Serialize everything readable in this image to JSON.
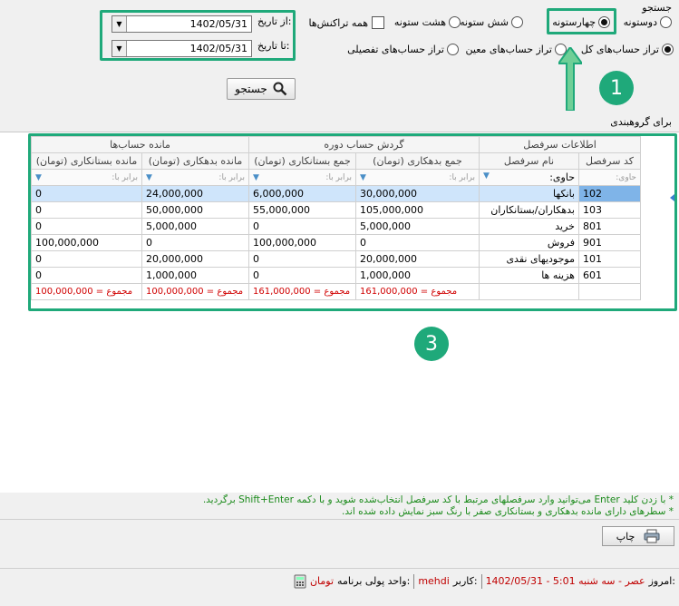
{
  "search": {
    "title": "جستجو",
    "button_label": "جستجو"
  },
  "columns_options": [
    {
      "label": "دوستونه",
      "selected": false
    },
    {
      "label": "چهارستونه",
      "selected": true
    },
    {
      "label": "شش ستونه",
      "selected": false
    },
    {
      "label": "هشت ستونه",
      "selected": false
    }
  ],
  "all_transactions_label": "همه تراکنش‌ها",
  "balance_options": [
    {
      "label": "تراز حساب‌های کل",
      "selected": true
    },
    {
      "label": "تراز حساب‌های معین",
      "selected": false
    },
    {
      "label": "تراز حساب‌های تفصیلی",
      "selected": false
    }
  ],
  "dates": {
    "from_label": "از تاریخ:",
    "from_value": "1402/05/31",
    "to_label": "تا تاریخ:",
    "to_value": "1402/05/31"
  },
  "badges": {
    "one": "1",
    "three": "3"
  },
  "grouping_label": "برای گروهبندی",
  "grid": {
    "groups": {
      "account_info": "اطلاعات سرفصل",
      "period_turnover": "گردش حساب دوره",
      "balance": "مانده حساب‌ها"
    },
    "headers": {
      "code": "کد سرفصل",
      "name": "نام سرفصل",
      "debit_sum": "جمع بدهکاری (تومان)",
      "credit_sum": "جمع بستانکاری (تومان)",
      "debit_balance": "مانده بدهکاری (تومان)",
      "credit_balance": "مانده بستانکاری (تومان)"
    },
    "filters": {
      "contains": "حاوی:",
      "equals": "برابر با:"
    },
    "rows": [
      {
        "code": "102",
        "name": "بانکها",
        "debit_sum": "30,000,000",
        "credit_sum": "6,000,000",
        "debit_balance": "24,000,000",
        "credit_balance": "0"
      },
      {
        "code": "103",
        "name": "بدهکاران/بستانکاران",
        "debit_sum": "105,000,000",
        "credit_sum": "55,000,000",
        "debit_balance": "50,000,000",
        "credit_balance": "0"
      },
      {
        "code": "801",
        "name": "خرید",
        "debit_sum": "5,000,000",
        "credit_sum": "0",
        "debit_balance": "5,000,000",
        "credit_balance": "0"
      },
      {
        "code": "901",
        "name": "فروش",
        "debit_sum": "0",
        "credit_sum": "100,000,000",
        "debit_balance": "0",
        "credit_balance": "100,000,000"
      },
      {
        "code": "101",
        "name": "موجودیهای نقدی",
        "debit_sum": "20,000,000",
        "credit_sum": "0",
        "debit_balance": "20,000,000",
        "credit_balance": "0"
      },
      {
        "code": "601",
        "name": "هزینه ها",
        "debit_sum": "1,000,000",
        "credit_sum": "0",
        "debit_balance": "1,000,000",
        "credit_balance": "0"
      }
    ],
    "totals": {
      "debit_sum": "مجموع = 161,000,000",
      "credit_sum": "مجموع = 161,000,000",
      "debit_balance": "مجموع = 100,000,000",
      "credit_balance": "مجموع = 100,000,000"
    }
  },
  "notes": {
    "line1": "* با زدن کلید Enter می‌توانید وارد سرفصلهای مرتبط با کد سرفصل انتخاب‌شده شوید و با دکمه Shift+Enter برگردید.",
    "line2": "* سطرهای دارای مانده بدهکاری و بستانکاری صفر با رنگ سبز نمایش داده شده اند."
  },
  "print_label": "چاپ",
  "status": {
    "today_label": "امروز:",
    "today_value": "1402/05/31 - 5:01 عصر - سه شنبه",
    "user_label": "کاربر:",
    "user_value": "mehdi",
    "currency_label": "واحد پولی برنامه:",
    "currency_value": "تومان"
  },
  "colors": {
    "accent": "#1fa97a",
    "sum": "#d00000",
    "note": "#1a8a1a",
    "selection": "#cfe5fb"
  }
}
